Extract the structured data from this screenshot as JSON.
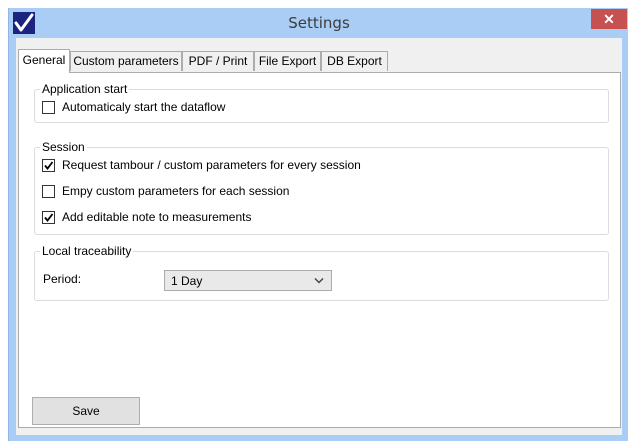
{
  "window": {
    "title": "Settings",
    "close_glyph": "✕",
    "app_icon": "checkmark-logo-icon",
    "accent_color": "#a9cdf5",
    "close_color": "#c75050"
  },
  "tabs": [
    {
      "label": "General",
      "active": true
    },
    {
      "label": "Custom parameters",
      "active": false
    },
    {
      "label": "PDF / Print",
      "active": false
    },
    {
      "label": "File Export",
      "active": false
    },
    {
      "label": "DB Export",
      "active": false
    }
  ],
  "application_start": {
    "title": "Application start",
    "options": [
      {
        "label": "Automaticaly start the dataflow",
        "checked": false
      }
    ]
  },
  "session": {
    "title": "Session",
    "options": [
      {
        "label": "Request tambour / custom parameters for every session",
        "checked": true
      },
      {
        "label": "Empy custom parameters for each session",
        "checked": false
      },
      {
        "label": "Add editable note to measurements",
        "checked": true
      }
    ]
  },
  "local_traceability": {
    "title": "Local traceability",
    "period_label": "Period:",
    "period_value": "1 Day"
  },
  "save_label": "Save"
}
